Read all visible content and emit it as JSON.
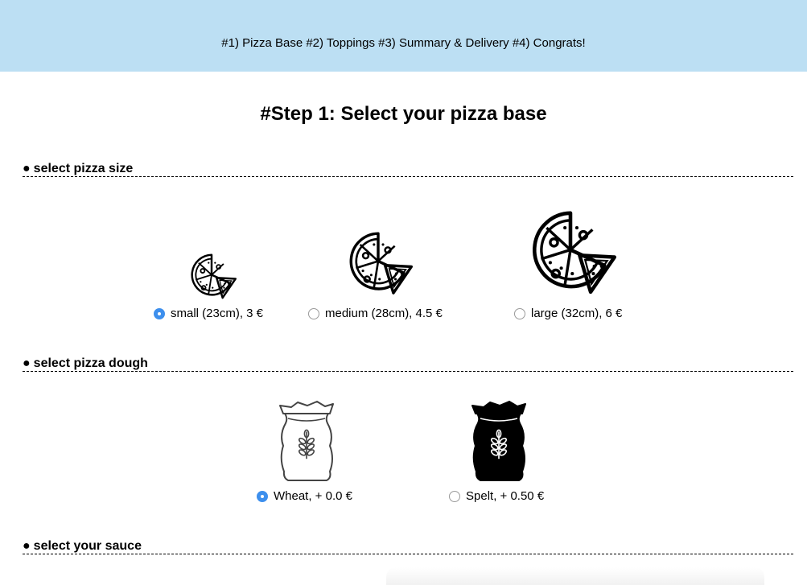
{
  "nav": {
    "steps": "#1) Pizza Base #2) Toppings #3) Summary & Delivery #4) Congrats!"
  },
  "title": "#Step 1: Select your pizza base",
  "sections": {
    "size": {
      "bullet": "●",
      "heading": "select pizza size"
    },
    "dough": {
      "bullet": "●",
      "heading": "select pizza dough"
    },
    "sauce": {
      "bullet": "●",
      "heading": "select your sauce"
    }
  },
  "sizes": [
    {
      "label": "small (23cm), 3 €",
      "selected": true,
      "icon": "pizza-icon"
    },
    {
      "label": "medium (28cm), 4.5 €",
      "selected": false,
      "icon": "pizza-icon"
    },
    {
      "label": "large (32cm), 6 €",
      "selected": false,
      "icon": "pizza-icon"
    }
  ],
  "doughs": [
    {
      "label": "Wheat, + 0.0 €",
      "selected": true,
      "icon": "flour-sack-outline-icon"
    },
    {
      "label": "Spelt, + 0.50 €",
      "selected": false,
      "icon": "flour-sack-filled-icon"
    }
  ],
  "colors": {
    "nav_bg": "#bcdff3",
    "radio_selected": "#3d8fed"
  }
}
